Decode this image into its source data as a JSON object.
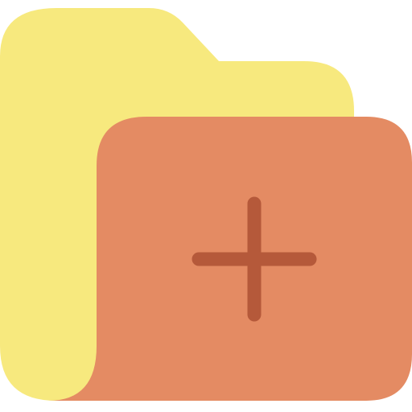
{
  "icon": {
    "name": "add-folder-icon",
    "colors": {
      "back": "#F7E97E",
      "front": "#E48B63",
      "plus": "#B5593A",
      "background": "#FFFFFF"
    }
  }
}
